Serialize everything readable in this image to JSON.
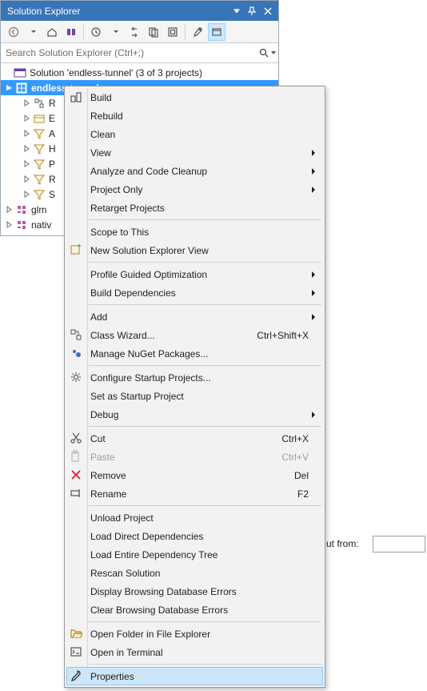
{
  "panel": {
    "title": "Solution Explorer",
    "search_placeholder": "Search Solution Explorer (Ctrl+;)",
    "solution_label": "Solution 'endless-tunnel' (3 of 3 projects)"
  },
  "tree": {
    "selected_project": "endless-tunnel",
    "items": [
      {
        "label": "R"
      },
      {
        "label": "E"
      },
      {
        "label": "A"
      },
      {
        "label": "H"
      },
      {
        "label": "P"
      },
      {
        "label": "R"
      },
      {
        "label": "S"
      }
    ],
    "siblings": [
      {
        "label": "glm"
      },
      {
        "label": "nativ"
      }
    ]
  },
  "bg": {
    "label_fragment": "ut from:"
  },
  "menu": {
    "build": "Build",
    "rebuild": "Rebuild",
    "clean": "Clean",
    "view": "View",
    "analyze": "Analyze and Code Cleanup",
    "project_only": "Project Only",
    "retarget": "Retarget Projects",
    "scope": "Scope to This",
    "new_view": "New Solution Explorer View",
    "pgo": "Profile Guided Optimization",
    "build_deps": "Build Dependencies",
    "add": "Add",
    "class_wizard": "Class Wizard...",
    "class_wizard_sc": "Ctrl+Shift+X",
    "nuget": "Manage NuGet Packages...",
    "config_startup": "Configure Startup Projects...",
    "set_startup": "Set as Startup Project",
    "debug": "Debug",
    "cut": "Cut",
    "cut_sc": "Ctrl+X",
    "paste": "Paste",
    "paste_sc": "Ctrl+V",
    "remove": "Remove",
    "remove_sc": "Del",
    "rename": "Rename",
    "rename_sc": "F2",
    "unload": "Unload Project",
    "load_direct": "Load Direct Dependencies",
    "load_tree": "Load Entire Dependency Tree",
    "rescan": "Rescan Solution",
    "disp_errors": "Display Browsing Database Errors",
    "clear_errors": "Clear Browsing Database Errors",
    "open_folder": "Open Folder in File Explorer",
    "open_terminal": "Open in Terminal",
    "properties": "Properties"
  }
}
